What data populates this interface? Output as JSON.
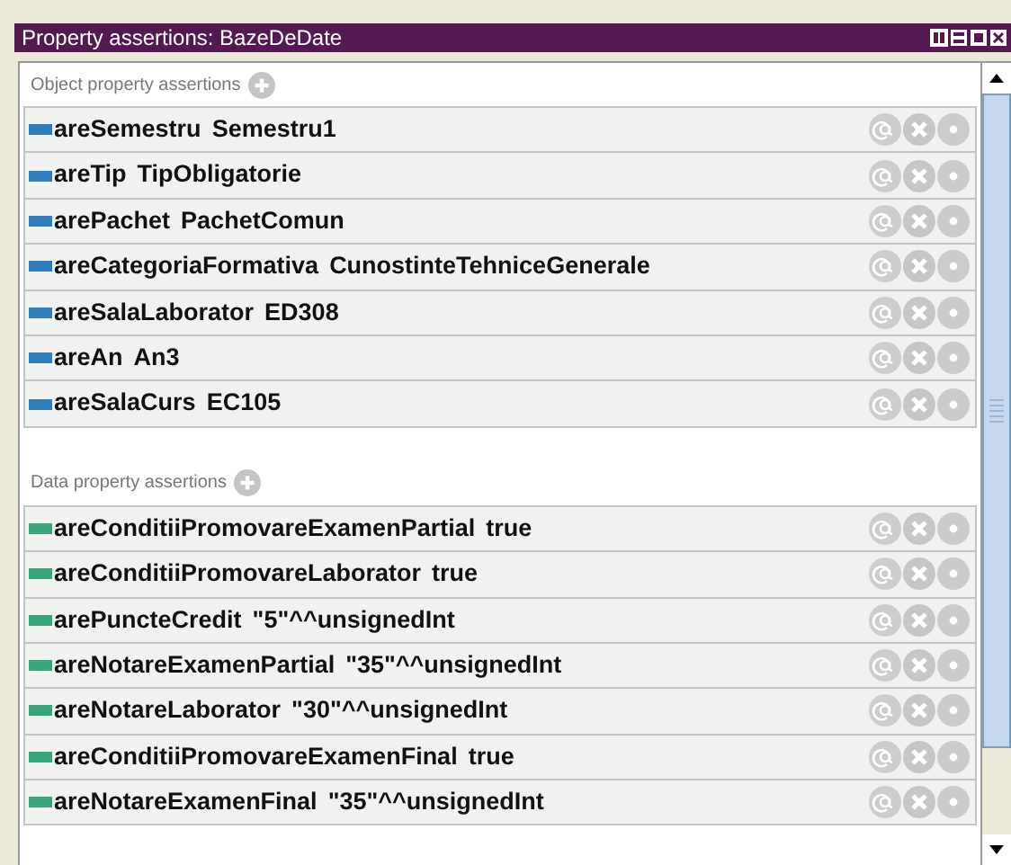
{
  "window": {
    "title": "Property assertions: BazeDeDate"
  },
  "sections": [
    {
      "kind": "object",
      "header": "Object property assertions",
      "rows": [
        {
          "property": "areSemestru",
          "value": "Semestru1"
        },
        {
          "property": "areTip",
          "value": "TipObligatorie"
        },
        {
          "property": "arePachet",
          "value": "PachetComun"
        },
        {
          "property": "areCategoriaFormativa",
          "value": "CunostinteTehniceGenerale"
        },
        {
          "property": "areSalaLaborator",
          "value": "ED308"
        },
        {
          "property": "areAn",
          "value": "An3"
        },
        {
          "property": "areSalaCurs",
          "value": "EC105"
        }
      ]
    },
    {
      "kind": "data",
      "header": "Data property assertions",
      "rows": [
        {
          "property": "areConditiiPromovareExamenPartial",
          "value": "true"
        },
        {
          "property": "areConditiiPromovareLaborator",
          "value": "true"
        },
        {
          "property": "arePuncteCredit",
          "value": "\"5\"^^unsignedInt"
        },
        {
          "property": "areNotareExamenPartial",
          "value": "\"35\"^^unsignedInt"
        },
        {
          "property": "areNotareLaborator",
          "value": "\"30\"^^unsignedInt"
        },
        {
          "property": "areConditiiPromovareExamenFinal",
          "value": "true"
        },
        {
          "property": "areNotareExamenFinal",
          "value": "\"35\"^^unsignedInt"
        }
      ]
    }
  ]
}
